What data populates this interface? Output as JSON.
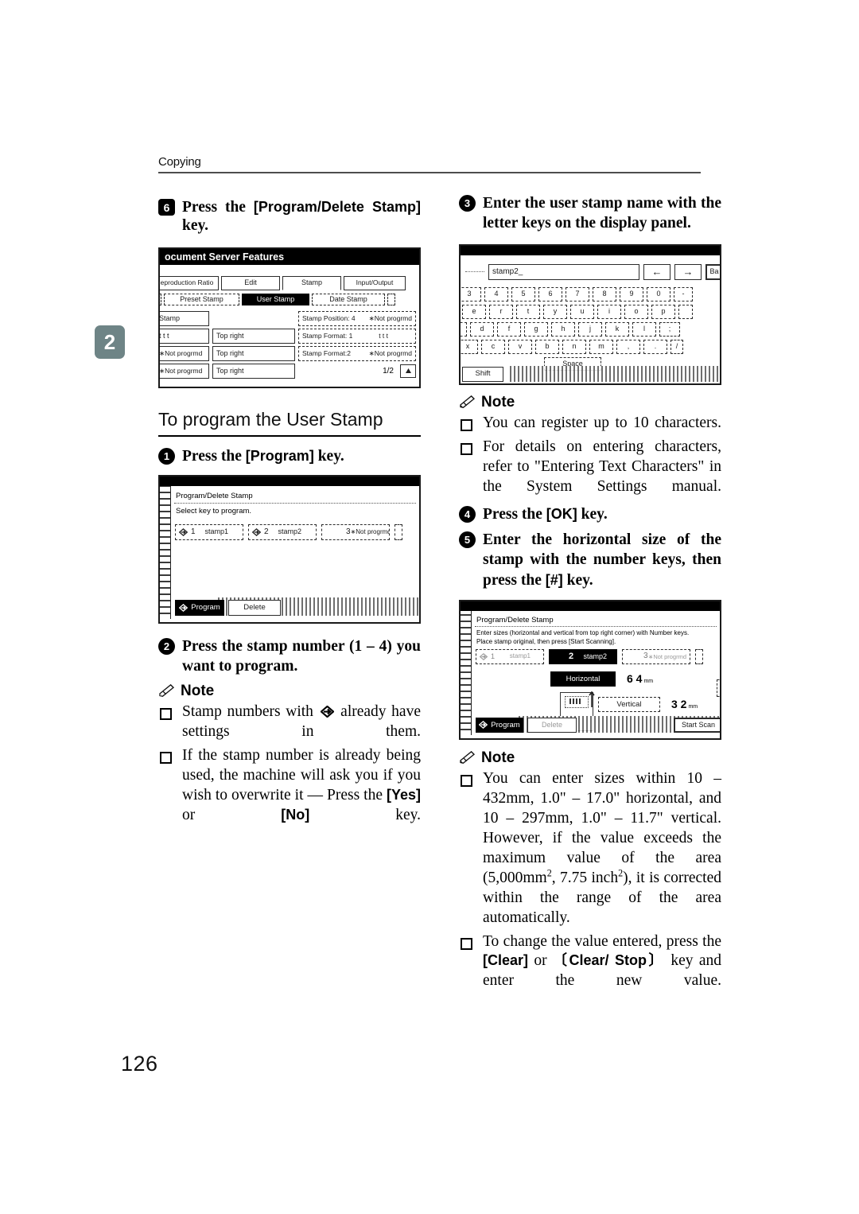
{
  "page": {
    "running_head": "Copying",
    "chapter_tab": "2",
    "page_number": "126",
    "tab_color": "#6e8486"
  },
  "left_column": {
    "step6": {
      "badge": "6",
      "text_before": "Press  the ",
      "key": "[Program/Delete Stamp]",
      "text_after": " key."
    },
    "figure_stamp": {
      "title": "ocument Server Features",
      "tabs": [
        {
          "label": "eproduction Ratio",
          "selected": false
        },
        {
          "label": "Edit",
          "selected": false
        },
        {
          "label": "Stamp",
          "selected": true
        },
        {
          "label": "Input/Output",
          "selected": false
        }
      ],
      "subtabs": [
        {
          "label": "Preset Stamp",
          "selected": false
        },
        {
          "label": "User Stamp",
          "selected": true
        },
        {
          "label": "Date Stamp",
          "selected": false
        }
      ],
      "rows": [
        {
          "left": "Stamp",
          "mid": "",
          "right_label": "Stamp Position: 4",
          "right_value": "∗Not progrmd"
        },
        {
          "left": "t t t",
          "mid": "Top right",
          "right_label": "Stamp Format: 1",
          "right_value": "t t t"
        },
        {
          "left": "∗Not progrmd",
          "mid": "Top right",
          "right_label": "Stamp Format:2",
          "right_value": "∗Not progrmd"
        },
        {
          "left": "∗Not progrmd",
          "mid": "Top right",
          "right_label": "",
          "right_value": ""
        }
      ],
      "page_indicator": "1/2",
      "scroll_icon": "triangle-up-icon"
    },
    "section_heading": "To program the User Stamp",
    "step1": {
      "badge": "1",
      "text_before": "Press the ",
      "key": "[Program]",
      "text_after": " key."
    },
    "figure_program": {
      "title": "Program/Delete Stamp",
      "instruction": "Select key to program.",
      "keys": [
        {
          "arrow": true,
          "num": "1",
          "name": "stamp1",
          "selected": false
        },
        {
          "arrow": true,
          "num": "2",
          "name": "stamp2",
          "selected": false
        },
        {
          "arrow": false,
          "num": "3",
          "name": "∗Not progrmd",
          "selected": false
        }
      ],
      "bottom_buttons": [
        {
          "label": "Program",
          "selected": true,
          "icon": "arrow-diamond-icon"
        },
        {
          "label": "Delete",
          "selected": false,
          "icon": ""
        }
      ]
    },
    "step2": {
      "badge": "2",
      "text": "Press the stamp number (1 – 4) you want to program."
    },
    "note": {
      "label": "Note",
      "icon": "pencil-note-icon",
      "bullets": [
        {
          "before": "Stamp numbers with ",
          "icon": "arrow-diamond-icon",
          "after": " already have settings in them."
        },
        {
          "before": "If the stamp number is already being used, the machine will ask you if you wish to overwrite it — Press the ",
          "key1": "[Yes]",
          "mid": " or ",
          "key2": "[No]",
          "after": " key."
        }
      ]
    }
  },
  "right_column": {
    "step3": {
      "badge": "3",
      "text": "Enter the user stamp name with the letter keys on the display panel."
    },
    "figure_keyboard": {
      "input_value": "stamp2_",
      "nav_keys": [
        "←",
        "→"
      ],
      "backspace_label": "Ba",
      "row_numbers": [
        "3",
        "4",
        "5",
        "6",
        "7",
        "8",
        "9",
        "0",
        "-"
      ],
      "row_top": [
        "e",
        "r",
        "t",
        "y",
        "u",
        "i",
        "o",
        "p"
      ],
      "row_home": [
        "d",
        "f",
        "g",
        "h",
        "j",
        "k",
        "l",
        ";"
      ],
      "row_bottom": [
        "x",
        "c",
        "v",
        "b",
        "n",
        "m",
        ",",
        ".",
        "/"
      ],
      "space_label": "Space",
      "shift_label": "Shift"
    },
    "note1": {
      "label": "Note",
      "icon": "pencil-note-icon",
      "bullets": [
        "You can register up to 10 characters.",
        "For details on entering characters, refer to \"Entering Text Characters\" in the System Settings manual."
      ]
    },
    "step4": {
      "badge": "4",
      "text_before": "Press the ",
      "key": "[OK]",
      "text_after": " key."
    },
    "step5": {
      "badge": "5",
      "text_before": "Enter the horizontal size of the stamp with the number keys, then press the ",
      "key": "[#]",
      "text_after": " key."
    },
    "figure_sizes": {
      "title": "Program/Delete Stamp",
      "instruction_line1": "Enter sizes (horizontal and vertical from top right corner) with Number keys.",
      "instruction_line2": "Place stamp original, then press [Start Scanning].",
      "keys": [
        {
          "arrow": true,
          "num": "1",
          "name": "stamp1",
          "selected": false
        },
        {
          "arrow": false,
          "num": "2",
          "name": "stamp2",
          "selected": true
        },
        {
          "arrow": false,
          "num": "3",
          "name": "∗Not progrmd",
          "selected": false
        }
      ],
      "horizontal_label": "Horizontal",
      "horizontal_value": "6 4",
      "horizontal_unit": "mm",
      "vertical_label": "Vertical",
      "vertical_value": "3 2",
      "vertical_unit": "mm",
      "bottom_buttons": [
        {
          "label": "Program",
          "selected": true,
          "icon": "arrow-diamond-icon"
        },
        {
          "label": "Delete",
          "selected": false,
          "icon": ""
        }
      ],
      "start_button": "Start Scan"
    },
    "note2": {
      "label": "Note",
      "icon": "pencil-note-icon",
      "bullet1_a": "You can enter sizes within 10 – 432mm, 1.0\" – 17.0\" horizontal, and 10 – 297mm, 1.0\" – 11.7\" vertical. However, if the value exceeds the maximum value of the area (5,000mm",
      "bullet1_sup1": "2",
      "bullet1_b": ", 7.75 inch",
      "bullet1_sup2": "2",
      "bullet1_c": "), it is corrected within the range of the area automatically.",
      "bullet2_before": "To change the value entered, press the ",
      "bullet2_key1": "[Clear]",
      "bullet2_mid": " or ",
      "bullet2_key2": "〔Clear/ Stop〕",
      "bullet2_after": " key and enter the new value."
    }
  }
}
